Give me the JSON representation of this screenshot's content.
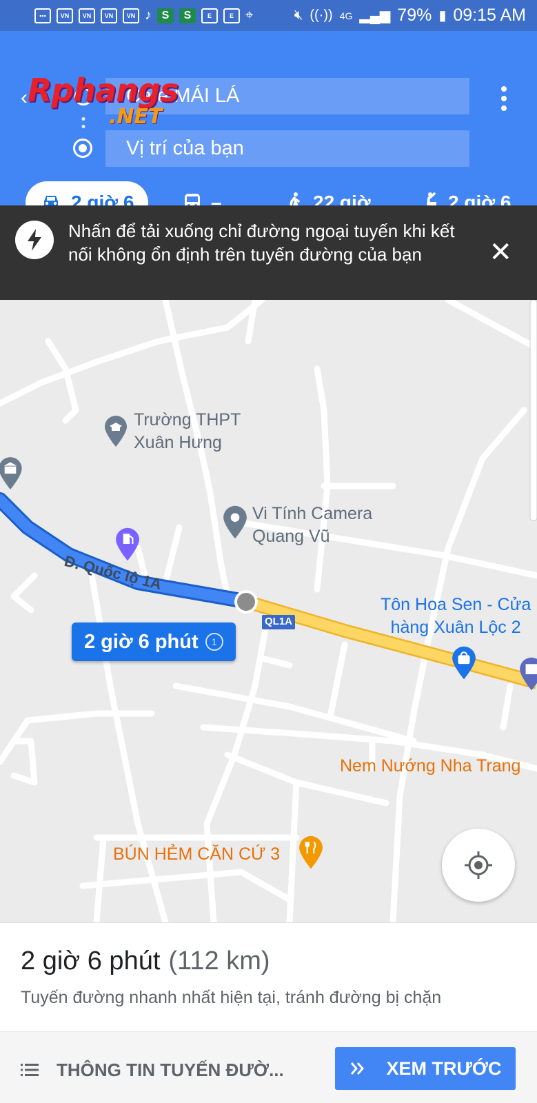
{
  "status_bar": {
    "battery": "79%",
    "time": "09:15 AM",
    "network": "4G"
  },
  "watermark": {
    "line1": "Rphangs",
    "line2": ".NET"
  },
  "directions": {
    "origin": "Café MÁI LÁ",
    "destination": "Vị trí của bạn"
  },
  "modes": [
    {
      "label": "2 giờ 6",
      "icon": "car-icon",
      "active": true
    },
    {
      "label": "–",
      "icon": "transit-icon",
      "active": false
    },
    {
      "label": "22 giờ",
      "icon": "walk-icon",
      "active": false
    },
    {
      "label": "2 giờ 6",
      "icon": "ride-hail-icon",
      "active": false
    }
  ],
  "banner": {
    "text": "Nhấn để tải xuống chỉ đường ngoại tuyến khi kết nối không ổn định trên tuyến đường của bạn"
  },
  "map": {
    "pois": [
      {
        "name": "Trường THPT\nXuân Hưng",
        "kind": "school"
      },
      {
        "name": "Vi Tính Camera\nQuang Vũ",
        "kind": "place"
      },
      {
        "name": "Tôn Hoa Sen - Cửa\nhàng Xuân Lộc 2",
        "kind": "shop"
      },
      {
        "name": "Nem Nướng Nha Trang",
        "kind": "food"
      },
      {
        "name": "BÚN HẺM CĂN CỨ 3",
        "kind": "food"
      }
    ],
    "road_name": "Đ. Quốc lộ 1A",
    "road_shield": "QL1A",
    "route_badge": "2 giờ 6 phút",
    "route_color": "#4285f4",
    "highway_color": "#fdd663"
  },
  "sheet": {
    "duration": "2 giờ 6 phút",
    "distance": "(112 km)",
    "subtitle": "Tuyến đường nhanh nhất hiện tại, tránh đường bị chặn",
    "info_button": "THÔNG TIN TUYẾN ĐƯỜ...",
    "preview_button": "XEM TRƯỚC"
  }
}
